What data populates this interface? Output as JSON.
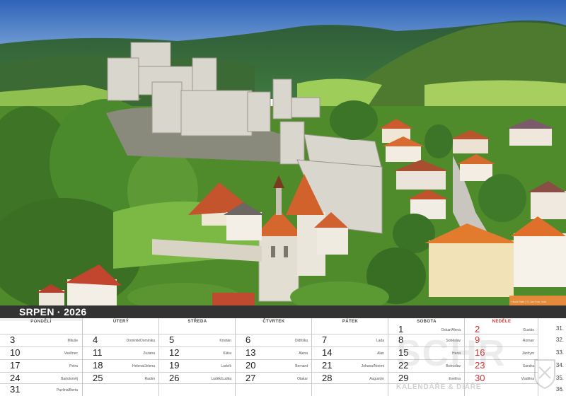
{
  "photo": {
    "description_key": "castle-photo",
    "credit": "Hrad Rabí | © Jan Kos, foto"
  },
  "month_bar": {
    "title": "SRPEN · 2026"
  },
  "weekdays": [
    "PONDĚLÍ",
    "ÚTERÝ",
    "STŘEDA",
    "ČTVRTEK",
    "PÁTEK",
    "SOBOTA",
    "NEDĚLE"
  ],
  "weeks": [
    {
      "days": [
        {
          "num": "",
          "name": ""
        },
        {
          "num": "",
          "name": ""
        },
        {
          "num": "",
          "name": ""
        },
        {
          "num": "",
          "name": ""
        },
        {
          "num": "",
          "name": ""
        },
        {
          "num": "1",
          "name": "Oskar/Alena"
        },
        {
          "num": "2",
          "name": "Gustáv"
        }
      ],
      "wk": "31."
    },
    {
      "days": [
        {
          "num": "3",
          "name": "Miluše"
        },
        {
          "num": "4",
          "name": "Dominik/Dominika"
        },
        {
          "num": "5",
          "name": "Kristián"
        },
        {
          "num": "6",
          "name": "Oldřiška"
        },
        {
          "num": "7",
          "name": "Lada"
        },
        {
          "num": "8",
          "name": "Soběslav"
        },
        {
          "num": "9",
          "name": "Roman"
        }
      ],
      "wk": "32."
    },
    {
      "days": [
        {
          "num": "10",
          "name": "Vavřinec"
        },
        {
          "num": "11",
          "name": "Zuzana"
        },
        {
          "num": "12",
          "name": "Klára"
        },
        {
          "num": "13",
          "name": "Alena"
        },
        {
          "num": "14",
          "name": "Alan"
        },
        {
          "num": "15",
          "name": "Hana"
        },
        {
          "num": "16",
          "name": "Jáchym"
        }
      ],
      "wk": "33."
    },
    {
      "days": [
        {
          "num": "17",
          "name": "Petra"
        },
        {
          "num": "18",
          "name": "Helena/Jelena"
        },
        {
          "num": "19",
          "name": "Ludvík"
        },
        {
          "num": "20",
          "name": "Bernard"
        },
        {
          "num": "21",
          "name": "Johana/Noemi"
        },
        {
          "num": "22",
          "name": "Bohuslav"
        },
        {
          "num": "23",
          "name": "Sandra"
        }
      ],
      "wk": "34."
    },
    {
      "days": [
        {
          "num": "24",
          "name": "Bartoloměj"
        },
        {
          "num": "25",
          "name": "Radim"
        },
        {
          "num": "26",
          "name": "Luděk/Ludka"
        },
        {
          "num": "27",
          "name": "Otakar"
        },
        {
          "num": "28",
          "name": "Augustýn"
        },
        {
          "num": "29",
          "name": "Evelína"
        },
        {
          "num": "30",
          "name": "Vladěna"
        }
      ],
      "wk": "35."
    },
    {
      "days": [
        {
          "num": "31",
          "name": "Pavlína/Berta"
        },
        {
          "num": "",
          "name": ""
        },
        {
          "num": "",
          "name": ""
        },
        {
          "num": "",
          "name": ""
        },
        {
          "num": "",
          "name": ""
        },
        {
          "num": "",
          "name": ""
        },
        {
          "num": "",
          "name": ""
        }
      ],
      "wk": "36."
    }
  ],
  "watermark": {
    "letters": "SCHR",
    "tag": "KALENDÁŘE & DIÁŘE"
  },
  "colors": {
    "accent_red": "#d23131",
    "month_bar_bg": "#333333"
  }
}
